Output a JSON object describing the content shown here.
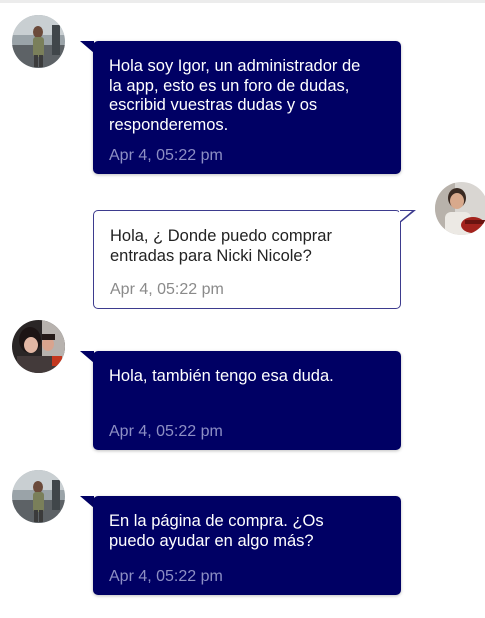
{
  "messages": [
    {
      "sender": "Igor",
      "avatar_icon": "user-avatar-photo",
      "side": "left",
      "style": "dark",
      "text": "Hola soy Igor, un administrador de\nla app, esto es un foro de dudas,\nescribid vuestras dudas y os\nresponderemos.",
      "time": "Apr 4, 05:22 pm"
    },
    {
      "avatar_icon": "user-avatar-photo",
      "side": "right",
      "style": "light",
      "text": "Hola, ¿ Donde puedo comprar\nentradas para Nicki Nicole?",
      "time": "Apr 4, 05:22 pm"
    },
    {
      "avatar_icon": "user-avatar-photo",
      "side": "left",
      "style": "dark",
      "text": "Hola, también tengo esa duda.",
      "time": "Apr 4, 05:22 pm"
    },
    {
      "avatar_icon": "user-avatar-photo",
      "side": "left",
      "style": "dark",
      "text": "En la página de compra. ¿Os\npuedo ayudar en algo más?",
      "time": "Apr 4, 05:22 pm"
    }
  ],
  "colors": {
    "bubble_dark": "#000064",
    "bubble_light_border": "#3d3b8e",
    "time_dark": "#8d8fc4",
    "time_light": "#8a8a8a"
  }
}
